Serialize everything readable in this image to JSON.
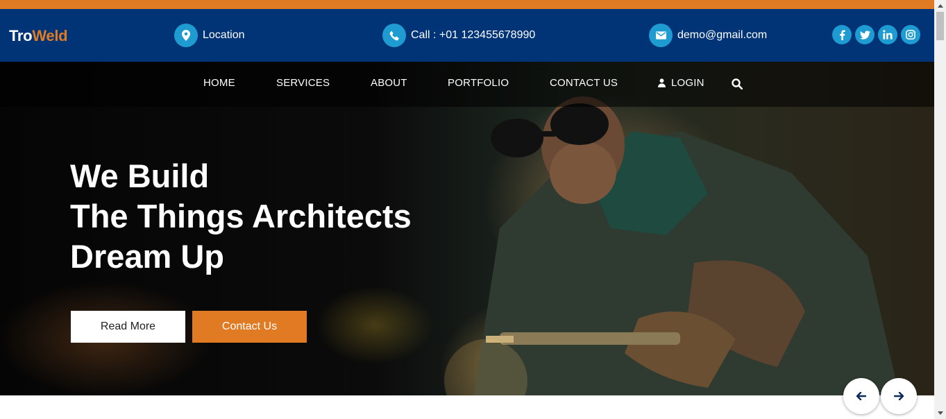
{
  "brand": {
    "part1": "Tro",
    "part2": "Weld"
  },
  "contact": {
    "location": "Location",
    "phone": "Call : +01 123455678990",
    "email": "demo@gmail.com"
  },
  "socials": [
    {
      "name": "facebook-icon",
      "glyph": "f"
    },
    {
      "name": "twitter-icon",
      "glyph": "t"
    },
    {
      "name": "linkedin-icon",
      "glyph": "in"
    },
    {
      "name": "instagram-icon",
      "glyph": "ig"
    }
  ],
  "nav": {
    "home": "HOME",
    "services": "SERVICES",
    "about": "ABOUT",
    "portfolio": "PORTFOLIO",
    "contact": "CONTACT US",
    "login": "LOGIN"
  },
  "hero": {
    "line1": "We Build",
    "line2": "The Things Architects",
    "line3": "Dream Up",
    "read_more": "Read More",
    "contact_us": "Contact Us"
  },
  "colors": {
    "accent": "#e07b24",
    "topbar": "#003477",
    "icon_circle": "#1e9bd1"
  },
  "icons": {
    "location": "map-marker-icon",
    "phone": "phone-icon",
    "email": "envelope-icon",
    "login": "user-icon",
    "search": "search-icon",
    "prev": "arrow-left-icon",
    "next": "arrow-right-icon"
  }
}
